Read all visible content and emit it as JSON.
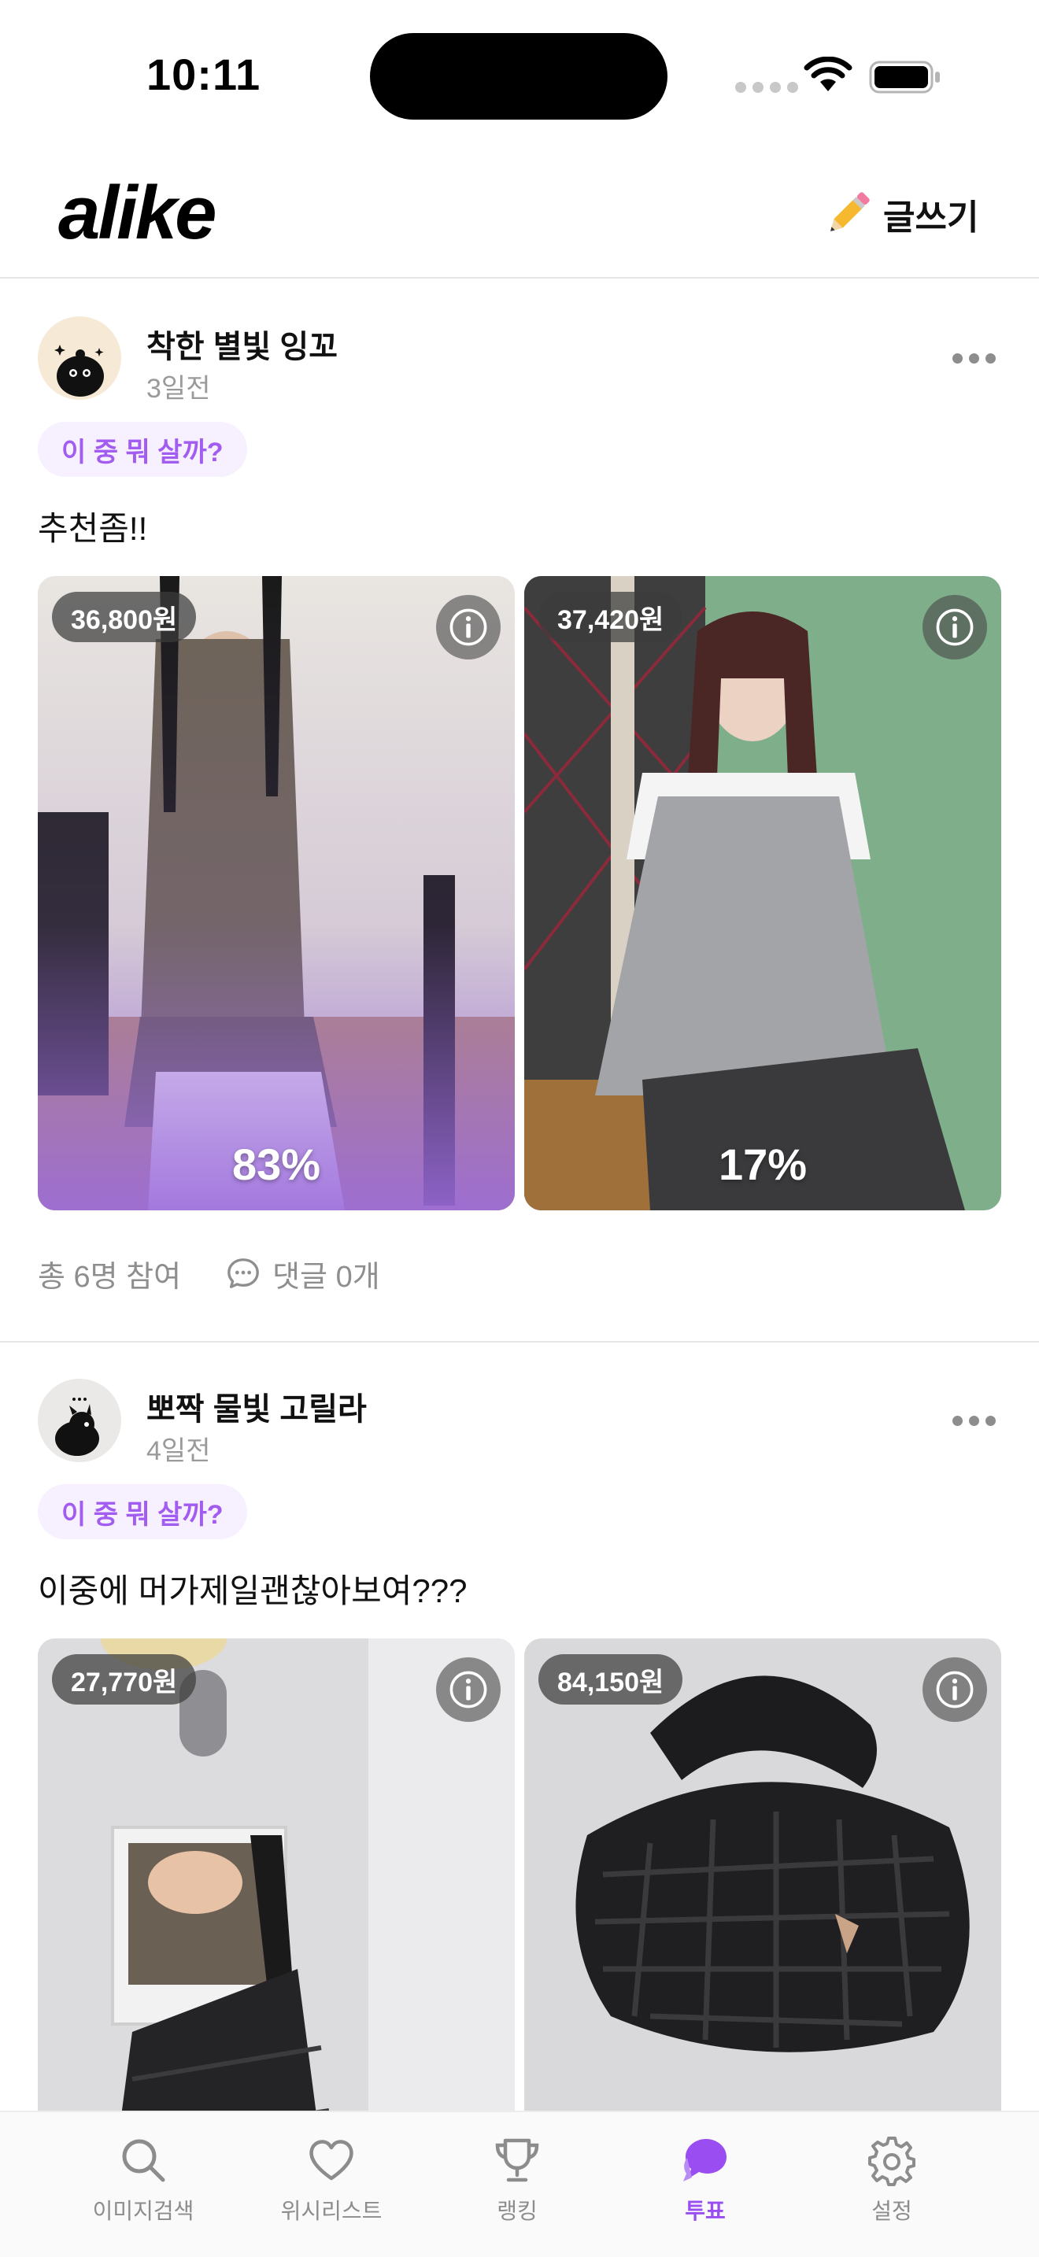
{
  "status_bar": {
    "time": "10:11"
  },
  "header": {
    "logo": "alike",
    "write_label": "글쓰기",
    "write_icon": "pencil-icon"
  },
  "posts": [
    {
      "author": "착한 별빛 잉꼬",
      "time_ago": "3일전",
      "tag": "이 중 뭐 살까?",
      "text": "추천좀!!",
      "options": [
        {
          "price": "36,800원",
          "percent": "83%",
          "fill_color": "#9b6bdc"
        },
        {
          "price": "37,420원",
          "percent": "17%"
        }
      ],
      "stats": {
        "participants": "총 6명 참여",
        "comments": "댓글 0개"
      }
    },
    {
      "author": "뽀짝 물빛 고릴라",
      "time_ago": "4일전",
      "tag": "이 중 뭐 살까?",
      "text": "이중에 머가제일괜찮아보여???",
      "options": [
        {
          "price": "27,770원"
        },
        {
          "price": "84,150원"
        }
      ]
    }
  ],
  "tabs": [
    {
      "label": "이미지검색",
      "icon": "search-icon",
      "active": false
    },
    {
      "label": "위시리스트",
      "icon": "heart-icon",
      "active": false
    },
    {
      "label": "랭킹",
      "icon": "trophy-icon",
      "active": false
    },
    {
      "label": "투표",
      "icon": "chat-bubble-icon",
      "active": true
    },
    {
      "label": "설정",
      "icon": "gear-icon",
      "active": false
    }
  ],
  "colors": {
    "accent": "#9a4df0",
    "tag_bg": "#f7f0ff",
    "tag_text": "#a35cf0"
  }
}
